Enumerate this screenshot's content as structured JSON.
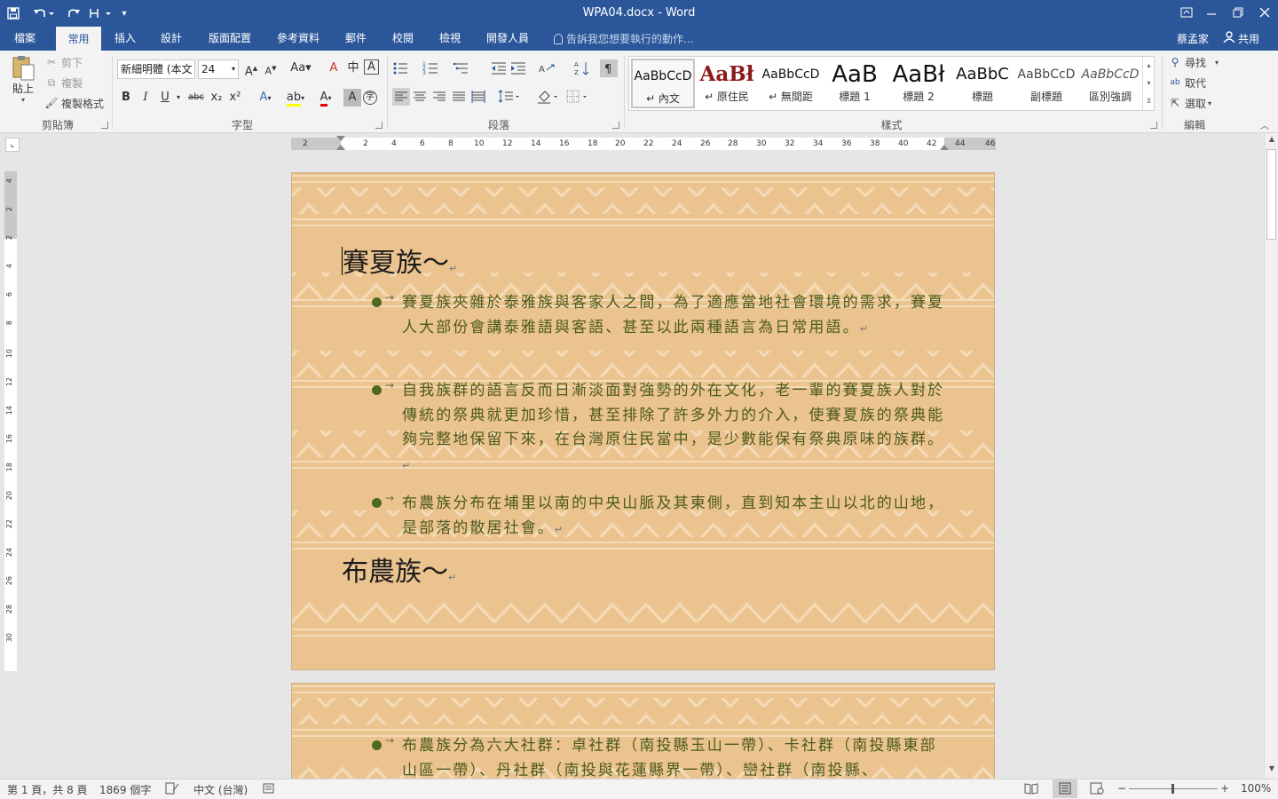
{
  "window": {
    "title": "WPA04.docx - Word",
    "quick_access": [
      "save-icon",
      "undo-icon",
      "redo-icon",
      "touch-mode-icon",
      "customize-icon"
    ],
    "controls": [
      "ribbon-display-icon",
      "minimize-icon",
      "restore-icon",
      "close-icon"
    ]
  },
  "tabs": [
    "檔案",
    "常用",
    "插入",
    "設計",
    "版面配置",
    "參考資料",
    "郵件",
    "校閱",
    "檢視",
    "開發人員"
  ],
  "active_tab": "常用",
  "tell_me": "告訴我您想要執行的動作...",
  "user_name": "蔡孟家",
  "share_label": "共用",
  "clipboard": {
    "paste": "貼上",
    "cut": "剪下",
    "copy": "複製",
    "format_painter": "複製格式",
    "label": "剪貼簿"
  },
  "font": {
    "name": "新細明體 (本文",
    "size": "24",
    "label": "字型",
    "buttons": [
      "B",
      "I",
      "U",
      "abc",
      "x₂",
      "x²"
    ]
  },
  "paragraph": {
    "label": "段落"
  },
  "styles": {
    "label": "樣式",
    "items": [
      {
        "sample": "AaBbCcD",
        "name": "↵ 內文"
      },
      {
        "sample": "AaBł",
        "name": "↵ 原住民"
      },
      {
        "sample": "AaBbCcD",
        "name": "↵ 無間距"
      },
      {
        "sample": "AaB",
        "name": "標題 1"
      },
      {
        "sample": "AaBł",
        "name": "標題 2"
      },
      {
        "sample": "AaBbC",
        "name": "標題"
      },
      {
        "sample": "AaBbCcD",
        "name": "副標題"
      },
      {
        "sample": "AaBbCcD",
        "name": "區別強調"
      }
    ]
  },
  "editing": {
    "find": "尋找",
    "replace": "取代",
    "select": "選取",
    "label": "編輯"
  },
  "ruler": {
    "h_numbers": [
      "2",
      "2",
      "4",
      "6",
      "8",
      "10",
      "12",
      "14",
      "16",
      "18",
      "20",
      "22",
      "24",
      "26",
      "28",
      "30",
      "32",
      "34",
      "36",
      "38",
      "40",
      "42",
      "44",
      "46"
    ],
    "v_numbers": [
      "4",
      "2",
      "2",
      "4",
      "6",
      "8",
      "10",
      "12",
      "14",
      "16",
      "18",
      "20",
      "22",
      "24",
      "26",
      "28",
      "30"
    ]
  },
  "document": {
    "page1": {
      "heading1": "賽夏族～",
      "bullets": [
        "賽夏族夾雜於泰雅族與客家人之間，為了適應當地社會環境的需求，賽夏人大部份會講泰雅語與客語、甚至以此兩種語言為日常用語。",
        "自我族群的語言反而日漸淡面對強勢的外在文化，老一輩的賽夏族人對於傳統的祭典就更加珍惜，甚至排除了許多外力的介入，使賽夏族的祭典能夠完整地保留下來，在台灣原住民當中，是少數能保有祭典原味的族群。",
        "布農族分布在埔里以南的中央山脈及其東側，直到知本主山以北的山地，是部落的散居社會。"
      ],
      "heading2": "布農族～"
    },
    "page2": {
      "bullets": [
        "布農族分為六大社群：卓社群（南投縣玉山一帶）、卡社群（南投縣東部山區一帶）、丹社群（南投與花蓮縣界一帶）、巒社群（南投縣、"
      ]
    },
    "paragraph_mark": "↵",
    "tab_mark": "→"
  },
  "statusbar": {
    "page": "第 1 頁，共 8 頁",
    "words": "1869 個字",
    "language": "中文 (台灣)",
    "zoom": "100%",
    "zoom_percent": 100
  },
  "colors": {
    "titlebar": "#2b579a",
    "page_background": "#ebc38f",
    "body_text": "#4c5a1c",
    "bullet": "#4c6a1f"
  }
}
